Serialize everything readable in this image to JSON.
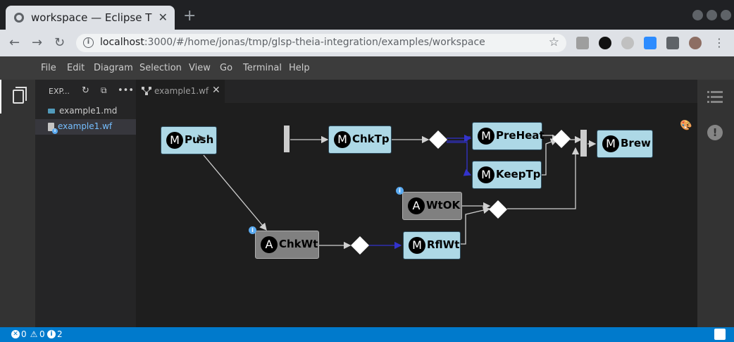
{
  "browser": {
    "tab_title": "workspace — Eclipse Theia",
    "url_host": "localhost",
    "url_rest": ":3000/#/home/jonas/tmp/glsp-theia-integration/examples/workspace"
  },
  "menu": [
    "File",
    "Edit",
    "Diagram",
    "Selection",
    "View",
    "Go",
    "Terminal",
    "Help"
  ],
  "explorer": {
    "title": "EXP...",
    "files": [
      {
        "label": "example1.md",
        "type": "md",
        "selected": false
      },
      {
        "label": "example1.wf",
        "type": "wf",
        "selected": true
      }
    ]
  },
  "editor": {
    "tab_label": "example1.wf"
  },
  "diagram": {
    "nodes": [
      {
        "id": "push",
        "kind": "M",
        "label": "Push",
        "type": "manual"
      },
      {
        "id": "chktp",
        "kind": "M",
        "label": "ChkTp",
        "type": "manual"
      },
      {
        "id": "preheat",
        "kind": "M",
        "label": "PreHeat",
        "type": "manual"
      },
      {
        "id": "keeptp",
        "kind": "M",
        "label": "KeepTp",
        "type": "manual"
      },
      {
        "id": "brew",
        "kind": "M",
        "label": "Brew",
        "type": "manual"
      },
      {
        "id": "wtok",
        "kind": "A",
        "label": "WtOK",
        "type": "automated"
      },
      {
        "id": "chkwt",
        "kind": "A",
        "label": "ChkWt",
        "type": "automated"
      },
      {
        "id": "rflwt",
        "kind": "M",
        "label": "RflWt",
        "type": "manual"
      }
    ],
    "colors": {
      "manual": "#add8e6",
      "automated": "#808080",
      "edge": "#d0d0d0",
      "weighted_edge": "#3333cc"
    }
  },
  "status": {
    "errors": "0",
    "warnings": "0",
    "infos": "2"
  },
  "colors": {
    "statusbar": "#007acc",
    "menubar": "#3c3c3c",
    "sidebar": "#252526",
    "editor": "#1e1e1e"
  }
}
